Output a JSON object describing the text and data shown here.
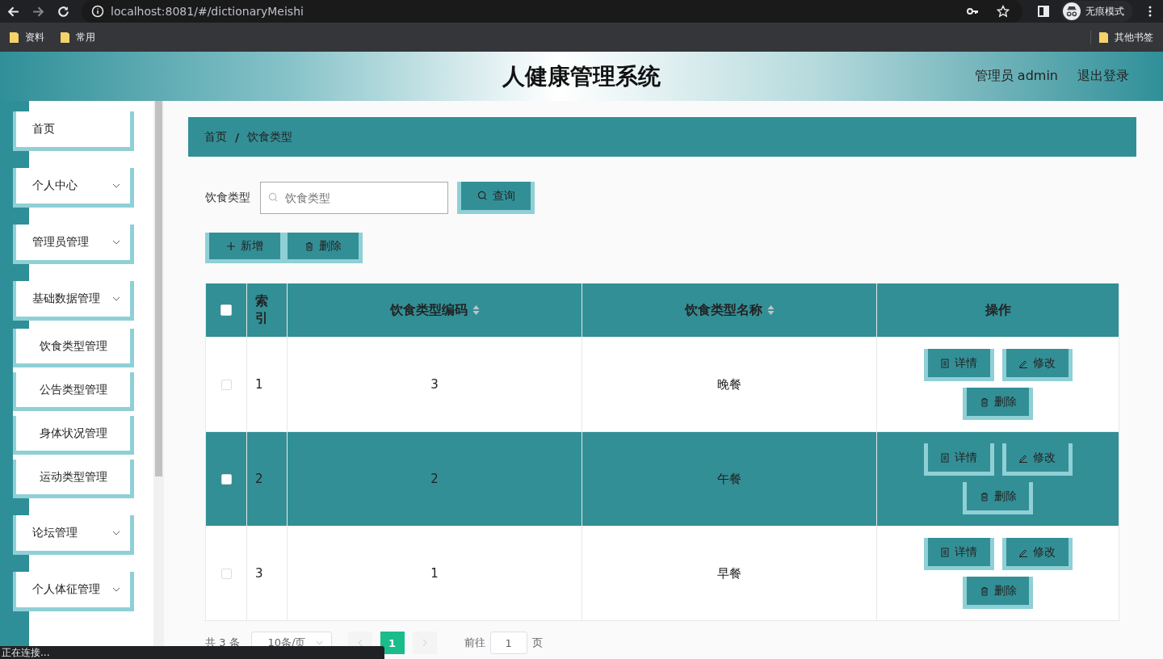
{
  "browser": {
    "url": "localhost:8081/#/dictionaryMeishi",
    "profile_label": "无痕模式",
    "bookmarks": [
      "资料",
      "常用"
    ],
    "other_bookmarks": "其他书签",
    "status": "正在连接..."
  },
  "header": {
    "title": "人健康管理系统",
    "user": "管理员 admin",
    "logout": "退出登录"
  },
  "sidebar": {
    "items": [
      {
        "label": "首页",
        "kind": "link"
      },
      {
        "label": "个人中心",
        "kind": "submenu"
      },
      {
        "label": "管理员管理",
        "kind": "submenu"
      },
      {
        "label": "基础数据管理",
        "kind": "submenu",
        "children": [
          {
            "label": "饮食类型管理"
          },
          {
            "label": "公告类型管理"
          },
          {
            "label": "身体状况管理"
          },
          {
            "label": "运动类型管理"
          }
        ]
      },
      {
        "label": "论坛管理",
        "kind": "submenu"
      },
      {
        "label": "个人体征管理",
        "kind": "submenu"
      }
    ]
  },
  "breadcrumb": [
    "首页",
    "饮食类型"
  ],
  "breadcrumb_separator": "/",
  "search": {
    "label": "饮食类型",
    "placeholder": "饮食类型",
    "button": "查询"
  },
  "actions": [
    "新增",
    "删除"
  ],
  "table": {
    "select_all_checked": false,
    "columns": [
      {
        "label": "索引",
        "sortable": false
      },
      {
        "label": "饮食类型编码",
        "sortable": true
      },
      {
        "label": "饮食类型名称",
        "sortable": true
      },
      {
        "label": "操作",
        "sortable": false
      }
    ],
    "rows": [
      {
        "index": "1",
        "code": "3",
        "name": "晚餐",
        "checked": false,
        "highlighted": false,
        "buttons": [
          "详情",
          "修改",
          "删除"
        ]
      },
      {
        "index": "2",
        "code": "2",
        "name": "午餐",
        "checked": false,
        "highlighted": true,
        "buttons": [
          "详情",
          "修改",
          "删除"
        ]
      },
      {
        "index": "3",
        "code": "1",
        "name": "早餐",
        "checked": false,
        "highlighted": false,
        "buttons": [
          "详情",
          "修改",
          "删除"
        ]
      }
    ]
  },
  "pagination": {
    "total": "共 3 条",
    "page_size": "10条/页",
    "pages": [
      {
        "label": "1",
        "selected": true
      }
    ],
    "goto_label": "前往",
    "goto_value": "1",
    "goto_suffix": "页"
  }
}
